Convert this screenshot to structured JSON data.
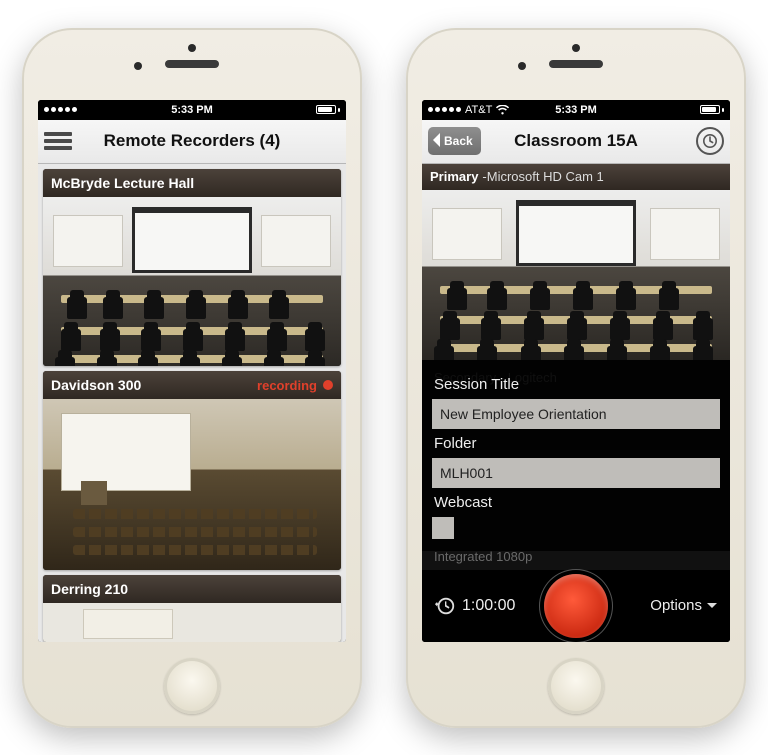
{
  "left": {
    "status": {
      "carrier": "",
      "time": "5:33 PM"
    },
    "nav": {
      "title": "Remote Recorders (4)"
    },
    "rooms": [
      {
        "name": "McBryde Lecture Hall",
        "recording": false
      },
      {
        "name": "Davidson 300",
        "recording": true,
        "recording_label": "recording"
      },
      {
        "name": "Derring 210",
        "recording": false
      }
    ]
  },
  "right": {
    "status": {
      "carrier": "AT&T",
      "time": "5:33 PM"
    },
    "nav": {
      "back": "Back",
      "title": "Classroom 15A"
    },
    "source": {
      "primary_label": "Primary",
      "separator": " - ",
      "device": "Microsoft HD Cam 1"
    },
    "form": {
      "session_title_label": "Session Title",
      "session_title_value": "New Employee Orientation",
      "folder_label": "Folder",
      "folder_value": "MLH001",
      "webcast_label": "Webcast",
      "webcast_checked": false
    },
    "ghost": {
      "secondary": "Secondary - Logitech",
      "integrated": "Integrated 1080p"
    },
    "footer": {
      "duration": "1:00:00",
      "options": "Options"
    }
  }
}
